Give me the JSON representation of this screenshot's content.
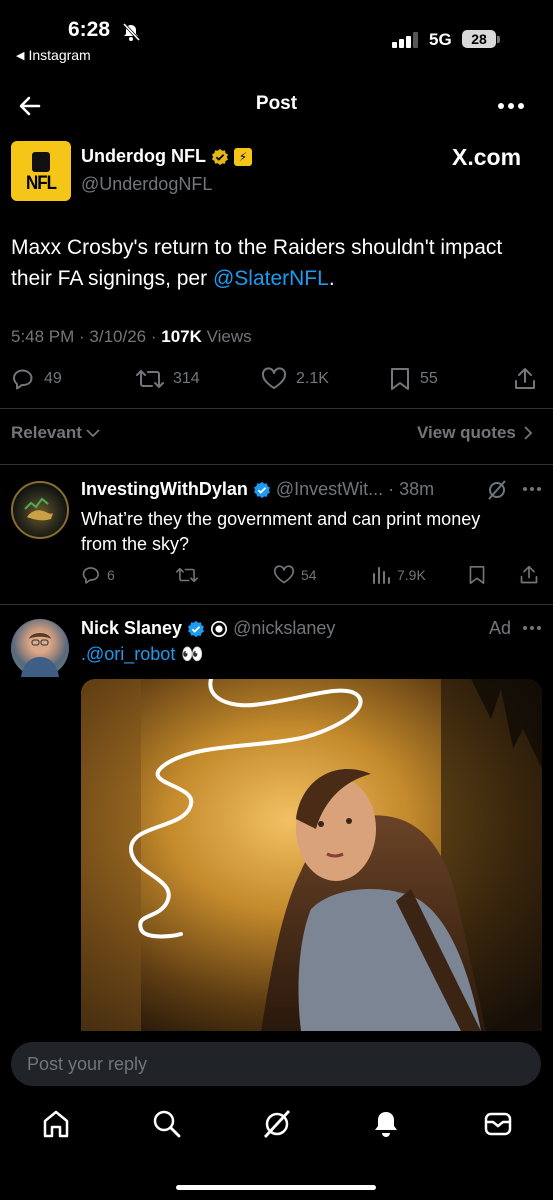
{
  "status_bar": {
    "time": "6:28",
    "back_app": "Instagram",
    "network": "5G",
    "battery": "28"
  },
  "nav": {
    "title": "Post"
  },
  "post": {
    "author_name": "Underdog NFL",
    "author_handle": "@UnderdogNFL",
    "logo_text": "NFL",
    "badge_text": "X.com",
    "text_before": "Maxx Crosby's return to the Raiders shouldn't impact their FA signings, per ",
    "mention": "@SlaterNFL",
    "text_after": ".",
    "timestamp": "5:48 PM · 3/10/26 · ",
    "views_count": "107K",
    "views_label": " Views",
    "replies": "49",
    "reposts": "314",
    "likes": "2.1K",
    "bookmarks": "55"
  },
  "filters": {
    "sort": "Relevant",
    "quotes": "View quotes"
  },
  "replies": [
    {
      "name": "InvestingWithDylan",
      "handle": "@InvestWit...",
      "time": "· 38m",
      "text": "What’re they the government and can print money from the sky?",
      "replies": "6",
      "likes": "54",
      "views": "7.9K"
    },
    {
      "name": "Nick Slaney",
      "handle": "@nickslaney",
      "ad": "Ad",
      "text": ".@ori_robot",
      "emoji": "👀"
    }
  ],
  "composer": {
    "placeholder": "Post your reply"
  },
  "colors": {
    "accent": "#1d9bf0",
    "verified_gold": "#e2b719",
    "brand_yellow": "#f5c518"
  },
  "icons": [
    "back-arrow-icon",
    "more-icon",
    "reply-icon",
    "repost-icon",
    "like-icon",
    "bookmark-icon",
    "share-icon",
    "views-icon",
    "grok-icon",
    "home-icon",
    "search-icon",
    "notifications-icon",
    "messages-icon"
  ]
}
